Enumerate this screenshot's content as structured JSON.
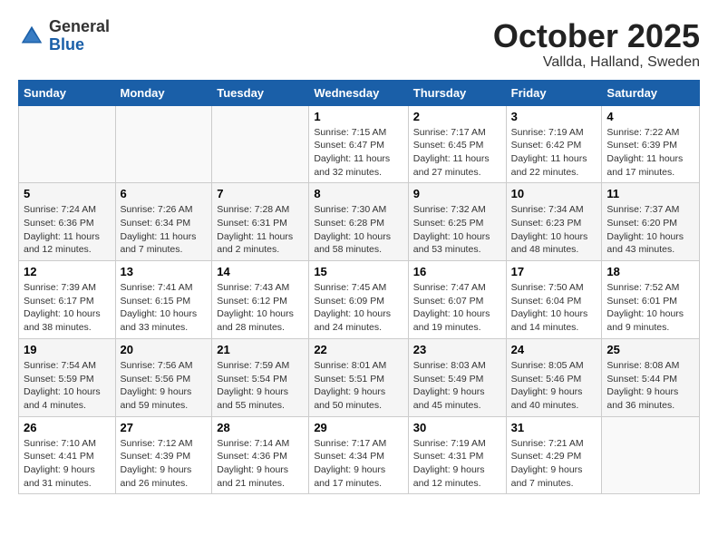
{
  "logo": {
    "general": "General",
    "blue": "Blue"
  },
  "title": "October 2025",
  "location": "Vallda, Halland, Sweden",
  "weekdays": [
    "Sunday",
    "Monday",
    "Tuesday",
    "Wednesday",
    "Thursday",
    "Friday",
    "Saturday"
  ],
  "weeks": [
    [
      {
        "day": "",
        "info": ""
      },
      {
        "day": "",
        "info": ""
      },
      {
        "day": "",
        "info": ""
      },
      {
        "day": "1",
        "info": "Sunrise: 7:15 AM\nSunset: 6:47 PM\nDaylight: 11 hours\nand 32 minutes."
      },
      {
        "day": "2",
        "info": "Sunrise: 7:17 AM\nSunset: 6:45 PM\nDaylight: 11 hours\nand 27 minutes."
      },
      {
        "day": "3",
        "info": "Sunrise: 7:19 AM\nSunset: 6:42 PM\nDaylight: 11 hours\nand 22 minutes."
      },
      {
        "day": "4",
        "info": "Sunrise: 7:22 AM\nSunset: 6:39 PM\nDaylight: 11 hours\nand 17 minutes."
      }
    ],
    [
      {
        "day": "5",
        "info": "Sunrise: 7:24 AM\nSunset: 6:36 PM\nDaylight: 11 hours\nand 12 minutes."
      },
      {
        "day": "6",
        "info": "Sunrise: 7:26 AM\nSunset: 6:34 PM\nDaylight: 11 hours\nand 7 minutes."
      },
      {
        "day": "7",
        "info": "Sunrise: 7:28 AM\nSunset: 6:31 PM\nDaylight: 11 hours\nand 2 minutes."
      },
      {
        "day": "8",
        "info": "Sunrise: 7:30 AM\nSunset: 6:28 PM\nDaylight: 10 hours\nand 58 minutes."
      },
      {
        "day": "9",
        "info": "Sunrise: 7:32 AM\nSunset: 6:25 PM\nDaylight: 10 hours\nand 53 minutes."
      },
      {
        "day": "10",
        "info": "Sunrise: 7:34 AM\nSunset: 6:23 PM\nDaylight: 10 hours\nand 48 minutes."
      },
      {
        "day": "11",
        "info": "Sunrise: 7:37 AM\nSunset: 6:20 PM\nDaylight: 10 hours\nand 43 minutes."
      }
    ],
    [
      {
        "day": "12",
        "info": "Sunrise: 7:39 AM\nSunset: 6:17 PM\nDaylight: 10 hours\nand 38 minutes."
      },
      {
        "day": "13",
        "info": "Sunrise: 7:41 AM\nSunset: 6:15 PM\nDaylight: 10 hours\nand 33 minutes."
      },
      {
        "day": "14",
        "info": "Sunrise: 7:43 AM\nSunset: 6:12 PM\nDaylight: 10 hours\nand 28 minutes."
      },
      {
        "day": "15",
        "info": "Sunrise: 7:45 AM\nSunset: 6:09 PM\nDaylight: 10 hours\nand 24 minutes."
      },
      {
        "day": "16",
        "info": "Sunrise: 7:47 AM\nSunset: 6:07 PM\nDaylight: 10 hours\nand 19 minutes."
      },
      {
        "day": "17",
        "info": "Sunrise: 7:50 AM\nSunset: 6:04 PM\nDaylight: 10 hours\nand 14 minutes."
      },
      {
        "day": "18",
        "info": "Sunrise: 7:52 AM\nSunset: 6:01 PM\nDaylight: 10 hours\nand 9 minutes."
      }
    ],
    [
      {
        "day": "19",
        "info": "Sunrise: 7:54 AM\nSunset: 5:59 PM\nDaylight: 10 hours\nand 4 minutes."
      },
      {
        "day": "20",
        "info": "Sunrise: 7:56 AM\nSunset: 5:56 PM\nDaylight: 9 hours\nand 59 minutes."
      },
      {
        "day": "21",
        "info": "Sunrise: 7:59 AM\nSunset: 5:54 PM\nDaylight: 9 hours\nand 55 minutes."
      },
      {
        "day": "22",
        "info": "Sunrise: 8:01 AM\nSunset: 5:51 PM\nDaylight: 9 hours\nand 50 minutes."
      },
      {
        "day": "23",
        "info": "Sunrise: 8:03 AM\nSunset: 5:49 PM\nDaylight: 9 hours\nand 45 minutes."
      },
      {
        "day": "24",
        "info": "Sunrise: 8:05 AM\nSunset: 5:46 PM\nDaylight: 9 hours\nand 40 minutes."
      },
      {
        "day": "25",
        "info": "Sunrise: 8:08 AM\nSunset: 5:44 PM\nDaylight: 9 hours\nand 36 minutes."
      }
    ],
    [
      {
        "day": "26",
        "info": "Sunrise: 7:10 AM\nSunset: 4:41 PM\nDaylight: 9 hours\nand 31 minutes."
      },
      {
        "day": "27",
        "info": "Sunrise: 7:12 AM\nSunset: 4:39 PM\nDaylight: 9 hours\nand 26 minutes."
      },
      {
        "day": "28",
        "info": "Sunrise: 7:14 AM\nSunset: 4:36 PM\nDaylight: 9 hours\nand 21 minutes."
      },
      {
        "day": "29",
        "info": "Sunrise: 7:17 AM\nSunset: 4:34 PM\nDaylight: 9 hours\nand 17 minutes."
      },
      {
        "day": "30",
        "info": "Sunrise: 7:19 AM\nSunset: 4:31 PM\nDaylight: 9 hours\nand 12 minutes."
      },
      {
        "day": "31",
        "info": "Sunrise: 7:21 AM\nSunset: 4:29 PM\nDaylight: 9 hours\nand 7 minutes."
      },
      {
        "day": "",
        "info": ""
      }
    ]
  ]
}
